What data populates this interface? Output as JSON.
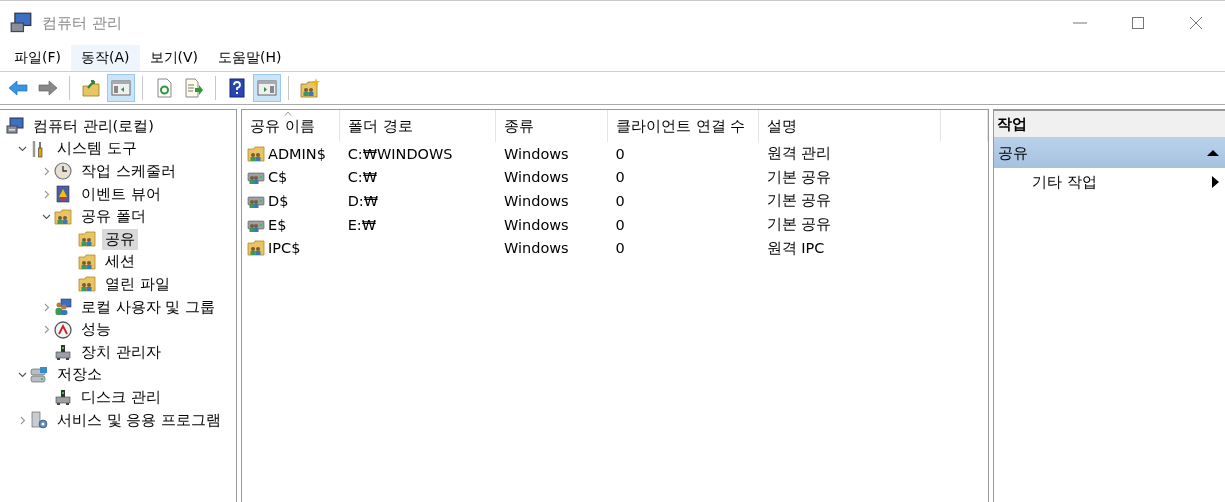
{
  "window": {
    "title": "컴퓨터 관리"
  },
  "menu": [
    {
      "label": "파일(F)",
      "highlighted": false
    },
    {
      "label": "동작(A)",
      "highlighted": true
    },
    {
      "label": "보기(V)",
      "highlighted": false
    },
    {
      "label": "도움말(H)",
      "highlighted": false
    }
  ],
  "toolbar": [
    {
      "kind": "back",
      "disabled": false,
      "on": false
    },
    {
      "kind": "forward",
      "disabled": true,
      "on": false
    },
    {
      "kind": "sep"
    },
    {
      "kind": "up",
      "disabled": false,
      "on": false
    },
    {
      "kind": "tree-pane",
      "disabled": false,
      "on": true
    },
    {
      "kind": "sep"
    },
    {
      "kind": "refresh",
      "disabled": false,
      "on": false
    },
    {
      "kind": "export",
      "disabled": false,
      "on": false
    },
    {
      "kind": "sep"
    },
    {
      "kind": "help",
      "disabled": false,
      "on": false
    },
    {
      "kind": "action-pane",
      "disabled": false,
      "on": true
    },
    {
      "kind": "sep"
    },
    {
      "kind": "new-share",
      "disabled": false,
      "on": false
    }
  ],
  "tree": [
    {
      "label": "컴퓨터 관리(로컬)",
      "kind": "computer",
      "selected": false,
      "children": [
        {
          "label": "시스템 도구",
          "kind": "tools",
          "expanded": true,
          "selected": false,
          "children": [
            {
              "label": "작업 스케줄러",
              "kind": "clock",
              "expanded": false,
              "selected": false
            },
            {
              "label": "이벤트 뷰어",
              "kind": "log",
              "expanded": false,
              "selected": false
            },
            {
              "label": "공유 폴더",
              "kind": "share",
              "expanded": true,
              "selected": false,
              "children": [
                {
                  "label": "공유",
                  "kind": "share",
                  "selected": true
                },
                {
                  "label": "세션",
                  "kind": "share",
                  "selected": false
                },
                {
                  "label": "열린 파일",
                  "kind": "share",
                  "selected": false
                }
              ]
            },
            {
              "label": "로컬 사용자 및 그룹",
              "kind": "users",
              "expanded": false,
              "selected": false
            },
            {
              "label": "성능",
              "kind": "gauge",
              "expanded": false,
              "selected": false
            },
            {
              "label": "장치 관리자",
              "kind": "device",
              "selected": false
            }
          ]
        },
        {
          "label": "저장소",
          "kind": "storage",
          "expanded": true,
          "selected": false,
          "children": [
            {
              "label": "디스크 관리",
              "kind": "device",
              "selected": false
            }
          ]
        },
        {
          "label": "서비스 및 응용 프로그램",
          "kind": "services",
          "expanded": false,
          "selected": false
        }
      ]
    }
  ],
  "table": {
    "columns": [
      {
        "label": "공유 이름",
        "sorted": true
      },
      {
        "label": "폴더 경로",
        "sorted": false
      },
      {
        "label": "종류",
        "sorted": false
      },
      {
        "label": "클라이언트 연결 수",
        "sorted": false
      },
      {
        "label": "설명",
        "sorted": false
      }
    ],
    "rows": [
      {
        "kind": "folder",
        "cells": [
          "ADMIN$",
          "C:₩WINDOWS",
          "Windows",
          "0",
          "원격 관리"
        ]
      },
      {
        "kind": "drive",
        "cells": [
          "C$",
          "C:₩",
          "Windows",
          "0",
          "기본 공유"
        ]
      },
      {
        "kind": "drive",
        "cells": [
          "D$",
          "D:₩",
          "Windows",
          "0",
          "기본 공유"
        ]
      },
      {
        "kind": "drive",
        "cells": [
          "E$",
          "E:₩",
          "Windows",
          "0",
          "기본 공유"
        ]
      },
      {
        "kind": "folder",
        "cells": [
          "IPC$",
          "",
          "Windows",
          "0",
          "원격 IPC"
        ]
      }
    ]
  },
  "actions": {
    "title": "작업",
    "sections": [
      {
        "label": "공유",
        "expanded": true,
        "items": [
          {
            "label": "기타 작업",
            "submenu": true
          }
        ]
      }
    ]
  }
}
